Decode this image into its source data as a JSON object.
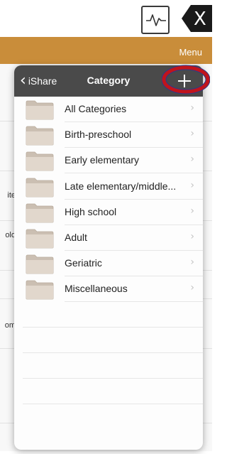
{
  "top_bar": {
    "close_label": "X"
  },
  "menu": {
    "label": "Menu"
  },
  "background_fragments": [
    "ite",
    "olo",
    "om"
  ],
  "popover": {
    "back_label": "iShare",
    "title": "Category",
    "add_icon": "plus-icon",
    "categories": [
      {
        "label": "All Categories"
      },
      {
        "label": "Birth-preschool"
      },
      {
        "label": "Early elementary"
      },
      {
        "label": "Late elementary/middle..."
      },
      {
        "label": "High school"
      },
      {
        "label": "Adult"
      },
      {
        "label": "Geriatric"
      },
      {
        "label": "Miscellaneous"
      }
    ]
  },
  "colors": {
    "accent": "#c98d3a",
    "header": "#4a4a4a",
    "annotation_ring": "#c0141c",
    "annotation_outline": "#2a3a8a"
  }
}
